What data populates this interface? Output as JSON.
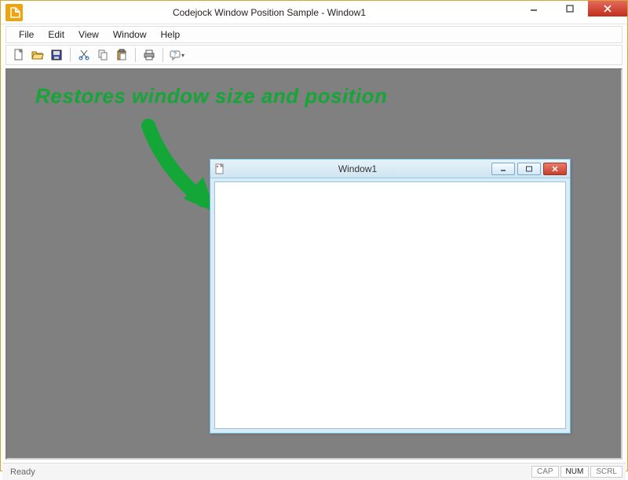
{
  "window": {
    "title": "Codejock Window Position Sample - Window1"
  },
  "menu": {
    "items": [
      "File",
      "Edit",
      "View",
      "Window",
      "Help"
    ]
  },
  "toolbar": {
    "new_icon": "new-file",
    "open_icon": "open-folder",
    "save_icon": "save-disk",
    "cut_icon": "cut",
    "copy_icon": "copy",
    "paste_icon": "paste",
    "print_icon": "print",
    "about_icon": "help"
  },
  "callout_text": "Restores window size and position",
  "child_window": {
    "title": "Window1"
  },
  "statusbar": {
    "message": "Ready",
    "indicators": [
      "CAP",
      "NUM",
      "SCRL"
    ],
    "active_indicator": "NUM"
  }
}
